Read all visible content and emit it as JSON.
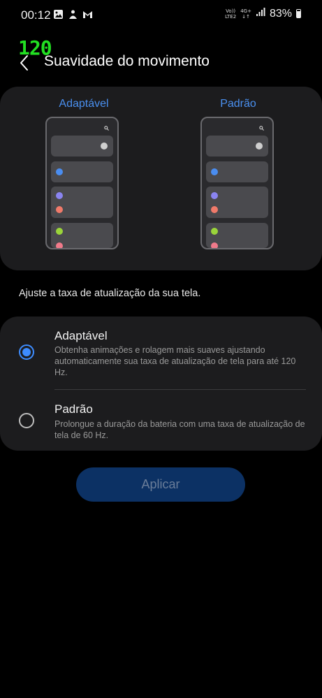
{
  "status_bar": {
    "time": "00:12",
    "network_top": "Vo))",
    "network_bottom": "LTE2",
    "data_top": "4G+",
    "data_bottom": "↓↑",
    "battery": "83%"
  },
  "fps_badge": "120",
  "header": {
    "title": "Suavidade do movimento"
  },
  "preview": {
    "left_label": "Adaptável",
    "right_label": "Padrão"
  },
  "description": "Ajuste a taxa de atualização da sua tela.",
  "options": [
    {
      "title": "Adaptável",
      "subtitle": "Obtenha animações e rolagem mais suaves ajustando automaticamente sua taxa de atualização de tela para até 120 Hz.",
      "selected": true
    },
    {
      "title": "Padrão",
      "subtitle": "Prolongue a duração da bateria com uma taxa de atualização de tela de 60 Hz.",
      "selected": false
    }
  ],
  "apply_label": "Aplicar",
  "colors": {
    "accent": "#3d8cff",
    "card": "#1c1c1e",
    "apply_bg": "#0c3164"
  }
}
